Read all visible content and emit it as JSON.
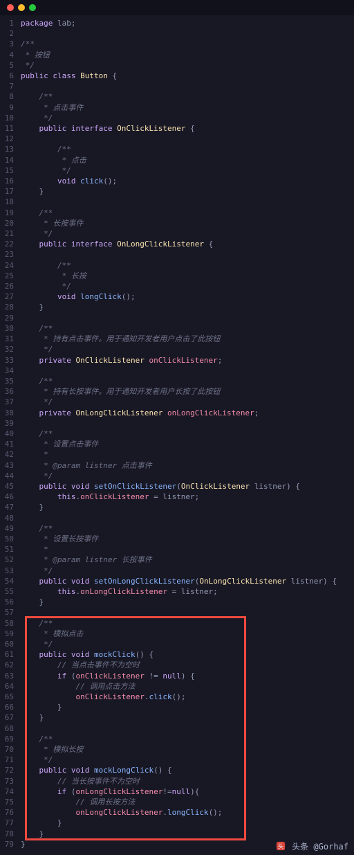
{
  "titlebar": {
    "dots": [
      "red",
      "yellow",
      "green"
    ]
  },
  "watermark": {
    "prefix": "头条",
    "handle": "@Gorhaf"
  },
  "highlight": {
    "startLine": 58,
    "endLine": 78
  },
  "code": {
    "lines": [
      {
        "n": 1,
        "t": [
          [
            "kw",
            "package"
          ],
          [
            "punc",
            " lab;"
          ]
        ]
      },
      {
        "n": 2,
        "t": []
      },
      {
        "n": 3,
        "t": [
          [
            "cmt",
            "/**"
          ]
        ]
      },
      {
        "n": 4,
        "t": [
          [
            "cmt",
            " * 按钮"
          ]
        ]
      },
      {
        "n": 5,
        "t": [
          [
            "cmt",
            " */"
          ]
        ]
      },
      {
        "n": 6,
        "t": [
          [
            "kw",
            "public"
          ],
          [
            "punc",
            " "
          ],
          [
            "kw",
            "class"
          ],
          [
            "punc",
            " "
          ],
          [
            "type",
            "Button"
          ],
          [
            "punc",
            " {"
          ]
        ]
      },
      {
        "n": 7,
        "t": []
      },
      {
        "n": 8,
        "t": [
          [
            "cmt",
            "    /**"
          ]
        ]
      },
      {
        "n": 9,
        "t": [
          [
            "cmt",
            "     * 点击事件"
          ]
        ]
      },
      {
        "n": 10,
        "t": [
          [
            "cmt",
            "     */"
          ]
        ]
      },
      {
        "n": 11,
        "t": [
          [
            "punc",
            "    "
          ],
          [
            "kw",
            "public"
          ],
          [
            "punc",
            " "
          ],
          [
            "kw",
            "interface"
          ],
          [
            "punc",
            " "
          ],
          [
            "type",
            "OnClickListener"
          ],
          [
            "punc",
            " {"
          ]
        ]
      },
      {
        "n": 12,
        "t": []
      },
      {
        "n": 13,
        "t": [
          [
            "cmt",
            "        /**"
          ]
        ]
      },
      {
        "n": 14,
        "t": [
          [
            "cmt",
            "         * 点击"
          ]
        ]
      },
      {
        "n": 15,
        "t": [
          [
            "cmt",
            "         */"
          ]
        ]
      },
      {
        "n": 16,
        "t": [
          [
            "punc",
            "        "
          ],
          [
            "kw",
            "void"
          ],
          [
            "punc",
            " "
          ],
          [
            "meth",
            "click"
          ],
          [
            "punc",
            "();"
          ]
        ]
      },
      {
        "n": 17,
        "t": [
          [
            "punc",
            "    }"
          ]
        ]
      },
      {
        "n": 18,
        "t": []
      },
      {
        "n": 19,
        "t": [
          [
            "cmt",
            "    /**"
          ]
        ]
      },
      {
        "n": 20,
        "t": [
          [
            "cmt",
            "     * 长按事件"
          ]
        ]
      },
      {
        "n": 21,
        "t": [
          [
            "cmt",
            "     */"
          ]
        ]
      },
      {
        "n": 22,
        "t": [
          [
            "punc",
            "    "
          ],
          [
            "kw",
            "public"
          ],
          [
            "punc",
            " "
          ],
          [
            "kw",
            "interface"
          ],
          [
            "punc",
            " "
          ],
          [
            "type",
            "OnLongClickListener"
          ],
          [
            "punc",
            " {"
          ]
        ]
      },
      {
        "n": 23,
        "t": []
      },
      {
        "n": 24,
        "t": [
          [
            "cmt",
            "        /**"
          ]
        ]
      },
      {
        "n": 25,
        "t": [
          [
            "cmt",
            "         * 长按"
          ]
        ]
      },
      {
        "n": 26,
        "t": [
          [
            "cmt",
            "         */"
          ]
        ]
      },
      {
        "n": 27,
        "t": [
          [
            "punc",
            "        "
          ],
          [
            "kw",
            "void"
          ],
          [
            "punc",
            " "
          ],
          [
            "meth",
            "longClick"
          ],
          [
            "punc",
            "();"
          ]
        ]
      },
      {
        "n": 28,
        "t": [
          [
            "punc",
            "    }"
          ]
        ]
      },
      {
        "n": 29,
        "t": []
      },
      {
        "n": 30,
        "t": [
          [
            "cmt",
            "    /**"
          ]
        ]
      },
      {
        "n": 31,
        "t": [
          [
            "cmt",
            "     * 持有点击事件。用于通知开发者用户点击了此按钮"
          ]
        ]
      },
      {
        "n": 32,
        "t": [
          [
            "cmt",
            "     */"
          ]
        ]
      },
      {
        "n": 33,
        "t": [
          [
            "punc",
            "    "
          ],
          [
            "kw",
            "private"
          ],
          [
            "punc",
            " "
          ],
          [
            "type",
            "OnClickListener"
          ],
          [
            "punc",
            " "
          ],
          [
            "var",
            "onClickListener"
          ],
          [
            "punc",
            ";"
          ]
        ]
      },
      {
        "n": 34,
        "t": []
      },
      {
        "n": 35,
        "t": [
          [
            "cmt",
            "    /**"
          ]
        ]
      },
      {
        "n": 36,
        "t": [
          [
            "cmt",
            "     * 持有长按事件。用于通知开发者用户长按了此按钮"
          ]
        ]
      },
      {
        "n": 37,
        "t": [
          [
            "cmt",
            "     */"
          ]
        ]
      },
      {
        "n": 38,
        "t": [
          [
            "punc",
            "    "
          ],
          [
            "kw",
            "private"
          ],
          [
            "punc",
            " "
          ],
          [
            "type",
            "OnLongClickListener"
          ],
          [
            "punc",
            " "
          ],
          [
            "var",
            "onLongClickListener"
          ],
          [
            "punc",
            ";"
          ]
        ]
      },
      {
        "n": 39,
        "t": []
      },
      {
        "n": 40,
        "t": [
          [
            "cmt",
            "    /**"
          ]
        ]
      },
      {
        "n": 41,
        "t": [
          [
            "cmt",
            "     * 设置点击事件"
          ]
        ]
      },
      {
        "n": 42,
        "t": [
          [
            "cmt",
            "     *"
          ]
        ]
      },
      {
        "n": 43,
        "t": [
          [
            "cmt",
            "     * @param listner 点击事件"
          ]
        ]
      },
      {
        "n": 44,
        "t": [
          [
            "cmt",
            "     */"
          ]
        ]
      },
      {
        "n": 45,
        "t": [
          [
            "punc",
            "    "
          ],
          [
            "kw",
            "public"
          ],
          [
            "punc",
            " "
          ],
          [
            "kw",
            "void"
          ],
          [
            "punc",
            " "
          ],
          [
            "meth",
            "setOnClickListener"
          ],
          [
            "punc",
            "("
          ],
          [
            "type",
            "OnClickListener"
          ],
          [
            "punc",
            " listner) {"
          ]
        ]
      },
      {
        "n": 46,
        "t": [
          [
            "punc",
            "        "
          ],
          [
            "kw",
            "this"
          ],
          [
            "punc",
            "."
          ],
          [
            "var",
            "onClickListener"
          ],
          [
            "punc",
            " = listner;"
          ]
        ]
      },
      {
        "n": 47,
        "t": [
          [
            "punc",
            "    }"
          ]
        ]
      },
      {
        "n": 48,
        "t": []
      },
      {
        "n": 49,
        "t": [
          [
            "cmt",
            "    /**"
          ]
        ]
      },
      {
        "n": 50,
        "t": [
          [
            "cmt",
            "     * 设置长按事件"
          ]
        ]
      },
      {
        "n": 51,
        "t": [
          [
            "cmt",
            "     *"
          ]
        ]
      },
      {
        "n": 52,
        "t": [
          [
            "cmt",
            "     * @param listner 长按事件"
          ]
        ]
      },
      {
        "n": 53,
        "t": [
          [
            "cmt",
            "     */"
          ]
        ]
      },
      {
        "n": 54,
        "t": [
          [
            "punc",
            "    "
          ],
          [
            "kw",
            "public"
          ],
          [
            "punc",
            " "
          ],
          [
            "kw",
            "void"
          ],
          [
            "punc",
            " "
          ],
          [
            "meth",
            "setOnLongClickListener"
          ],
          [
            "punc",
            "("
          ],
          [
            "type",
            "OnLongClickListener"
          ],
          [
            "punc",
            " listner) {"
          ]
        ]
      },
      {
        "n": 55,
        "t": [
          [
            "punc",
            "        "
          ],
          [
            "kw",
            "this"
          ],
          [
            "punc",
            "."
          ],
          [
            "var",
            "onLongClickListener"
          ],
          [
            "punc",
            " = listner;"
          ]
        ]
      },
      {
        "n": 56,
        "t": [
          [
            "punc",
            "    }"
          ]
        ]
      },
      {
        "n": 57,
        "t": []
      },
      {
        "n": 58,
        "t": [
          [
            "cmt",
            "    /**"
          ]
        ]
      },
      {
        "n": 59,
        "t": [
          [
            "cmt",
            "     * 模拟点击"
          ]
        ]
      },
      {
        "n": 60,
        "t": [
          [
            "cmt",
            "     */"
          ]
        ]
      },
      {
        "n": 61,
        "t": [
          [
            "punc",
            "    "
          ],
          [
            "kw",
            "public"
          ],
          [
            "punc",
            " "
          ],
          [
            "kw",
            "void"
          ],
          [
            "punc",
            " "
          ],
          [
            "meth",
            "mockClick"
          ],
          [
            "punc",
            "() {"
          ]
        ]
      },
      {
        "n": 62,
        "t": [
          [
            "cmt",
            "        // 当点击事件不为空时"
          ]
        ]
      },
      {
        "n": 63,
        "t": [
          [
            "punc",
            "        "
          ],
          [
            "kw",
            "if"
          ],
          [
            "punc",
            " ("
          ],
          [
            "var",
            "onClickListener"
          ],
          [
            "punc",
            " != "
          ],
          [
            "kw",
            "null"
          ],
          [
            "punc",
            ") {"
          ]
        ]
      },
      {
        "n": 64,
        "t": [
          [
            "cmt",
            "            // 调用点击方法"
          ]
        ]
      },
      {
        "n": 65,
        "t": [
          [
            "punc",
            "            "
          ],
          [
            "var",
            "onClickListener"
          ],
          [
            "punc",
            "."
          ],
          [
            "meth",
            "click"
          ],
          [
            "punc",
            "();"
          ]
        ]
      },
      {
        "n": 66,
        "t": [
          [
            "punc",
            "        }"
          ]
        ]
      },
      {
        "n": 67,
        "t": [
          [
            "punc",
            "    }"
          ]
        ]
      },
      {
        "n": 68,
        "t": []
      },
      {
        "n": 69,
        "t": [
          [
            "cmt",
            "    /**"
          ]
        ]
      },
      {
        "n": 70,
        "t": [
          [
            "cmt",
            "     * 模拟长按"
          ]
        ]
      },
      {
        "n": 71,
        "t": [
          [
            "cmt",
            "     */"
          ]
        ]
      },
      {
        "n": 72,
        "t": [
          [
            "punc",
            "    "
          ],
          [
            "kw",
            "public"
          ],
          [
            "punc",
            " "
          ],
          [
            "kw",
            "void"
          ],
          [
            "punc",
            " "
          ],
          [
            "meth",
            "mockLongClick"
          ],
          [
            "punc",
            "() {"
          ]
        ]
      },
      {
        "n": 73,
        "t": [
          [
            "cmt",
            "        // 当长按事件不为空时"
          ]
        ]
      },
      {
        "n": 74,
        "t": [
          [
            "punc",
            "        "
          ],
          [
            "kw",
            "if"
          ],
          [
            "punc",
            " ("
          ],
          [
            "var",
            "onLongClickListener"
          ],
          [
            "punc",
            "!="
          ],
          [
            "kw",
            "null"
          ],
          [
            "punc",
            "){"
          ]
        ]
      },
      {
        "n": 75,
        "t": [
          [
            "cmt",
            "            // 调用长按方法"
          ]
        ]
      },
      {
        "n": 76,
        "t": [
          [
            "punc",
            "            "
          ],
          [
            "var",
            "onLongClickListener"
          ],
          [
            "punc",
            "."
          ],
          [
            "meth",
            "longClick"
          ],
          [
            "punc",
            "();"
          ]
        ]
      },
      {
        "n": 77,
        "t": [
          [
            "punc",
            "        }"
          ]
        ]
      },
      {
        "n": 78,
        "t": [
          [
            "punc",
            "    }"
          ]
        ]
      },
      {
        "n": 79,
        "t": [
          [
            "punc",
            "}"
          ]
        ]
      }
    ]
  }
}
